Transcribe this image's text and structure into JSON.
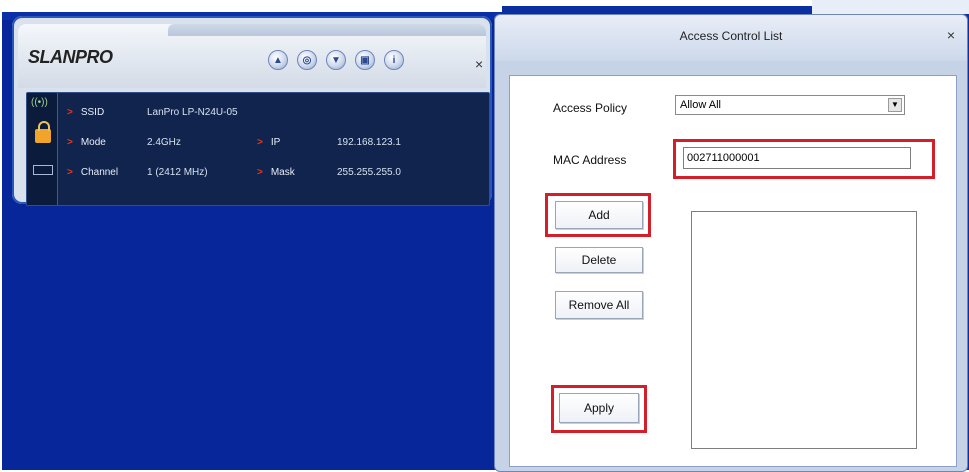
{
  "utility": {
    "logo": "SLANPRO",
    "toolbar_icons": [
      "ap-mode-icon",
      "config-icon",
      "wireless-icon",
      "settings-icon",
      "info-icon"
    ],
    "close": "×",
    "status": {
      "ssid_label": "SSID",
      "ssid_value": "LanPro LP-N24U-05",
      "mode_label": "Mode",
      "mode_value": "2.4GHz",
      "channel_label": "Channel",
      "channel_value": "1 (2412 MHz)",
      "ip_label": "IP",
      "ip_value": "192.168.123.1",
      "mask_label": "Mask",
      "mask_value": "255.255.255.0"
    }
  },
  "dialog": {
    "title": "Access Control List",
    "close": "×",
    "access_policy_label": "Access Policy",
    "access_policy_value": "Allow All",
    "mac_label": "MAC Address",
    "mac_value": "002711000001",
    "add_label": "Add",
    "delete_label": "Delete",
    "remove_all_label": "Remove All",
    "apply_label": "Apply"
  },
  "highlight_color": "#d21f2a"
}
